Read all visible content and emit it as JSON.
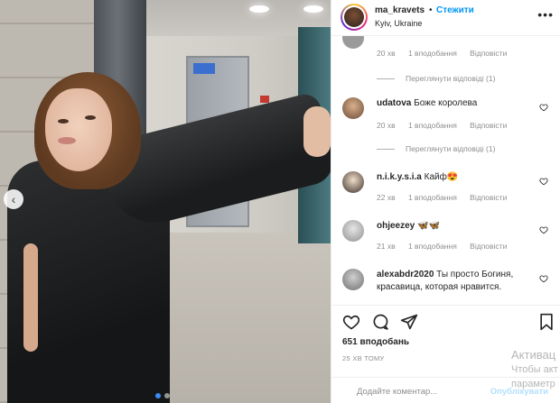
{
  "header": {
    "username": "ma_kravets",
    "separator": "•",
    "follow_label": "Стежити",
    "location": "Kyiv, Ukraine",
    "more_icon": "more-icon"
  },
  "comments": [
    {
      "partial": true,
      "time": "20 хв",
      "likes": "1 вподобання",
      "reply": "Відповісти",
      "view_replies": "Переглянути відповіді (1)"
    },
    {
      "username": "udatova",
      "text": "Боже королева",
      "time": "20 хв",
      "likes": "1 вподобання",
      "reply": "Відповісти",
      "view_replies": "Переглянути відповіді (1)"
    },
    {
      "username": "n.i.k.y.s.i.a",
      "text": "Кайф😍",
      "time": "22 хв",
      "likes": "1 вподобання",
      "reply": "Відповісти"
    },
    {
      "username": "ohjeezey",
      "text": "🦋🦋",
      "time": "21 хв",
      "likes": "1 вподобання",
      "reply": "Відповісти"
    },
    {
      "username": "alexabdr2020",
      "text": "Ты просто Богиня, красавица, которая нравится."
    }
  ],
  "actions": {
    "like_icon": "heart-icon",
    "comment_icon": "comment-icon",
    "share_icon": "share-icon",
    "save_icon": "bookmark-icon"
  },
  "likes_count": "651 вподобань",
  "time_ago": "25 хв тому",
  "add_comment": {
    "placeholder": "Додайте коментар...",
    "publish_label": "Опублікувати"
  },
  "watermark": {
    "line1": "Активац",
    "line2": "Чтобы акт",
    "line3": "параметр"
  },
  "photo": {
    "prev_icon": "chevron-left-icon",
    "carousel_count": 2,
    "active_index": 1
  },
  "colors": {
    "accent": "#0095f6",
    "text": "#262626",
    "muted": "#8e8e8e"
  }
}
